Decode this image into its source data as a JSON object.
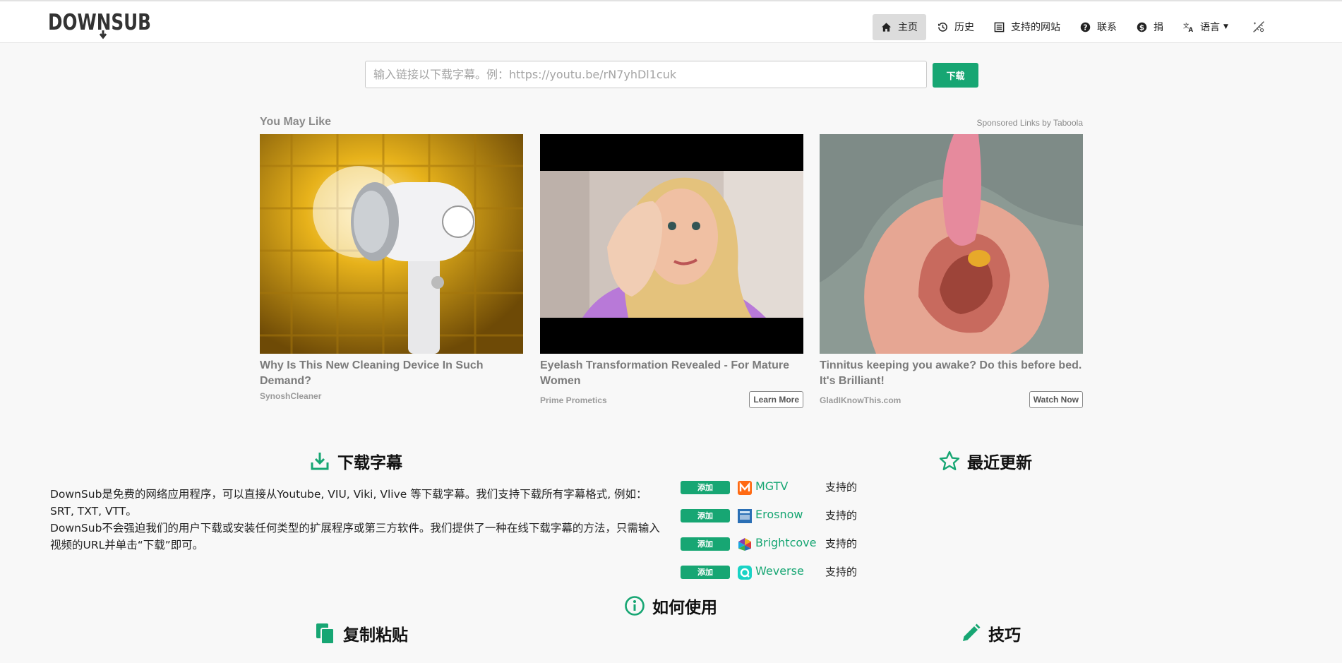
{
  "brand": {
    "logo_text": "DOWNSUB"
  },
  "nav": {
    "home": "主页",
    "history": "历史",
    "supported_sites": "支持的网站",
    "contact": "联系",
    "donate": "捐",
    "language": "语言"
  },
  "search": {
    "placeholder": "输入链接以下载字幕。例：https://youtu.be/rN7yhDl1cuk",
    "value": "",
    "button": "下载"
  },
  "ads": {
    "title": "You May Like",
    "sponsor": "Sponsored Links by Taboola",
    "items": [
      {
        "title": "Why Is This New Cleaning Device In Such Demand?",
        "brand": "SynoshCleaner",
        "cta": ""
      },
      {
        "title": "Eyelash Transformation Revealed - For Mature Women",
        "brand": "Prime Prometics",
        "cta": "Learn More"
      },
      {
        "title": "Tinnitus keeping you awake? Do this before bed. It's Brilliant!",
        "brand": "GladIKnowThis.com",
        "cta": "Watch Now"
      }
    ]
  },
  "download_section": {
    "heading": "下载字幕",
    "paragraph1": "DownSub是免费的网络应用程序，可以直接从Youtube, VIU, Viki, Vlive 等下载字幕。我们支持下载所有字幕格式, 例如：SRT, TXT, VTT。",
    "paragraph2": "DownSub不会强迫我们的用户下载或安装任何类型的扩展程序或第三方软件。我们提供了一种在线下载字幕的方法，只需输入视频的URL并单击“下载”即可。"
  },
  "recent_updates": {
    "heading": "最近更新",
    "items": [
      {
        "badge": "添加",
        "name": "MGTV",
        "status": "支持的",
        "logo": "mgtv-logo",
        "color": "#ff6a13"
      },
      {
        "badge": "添加",
        "name": "Erosnow",
        "status": "支持的",
        "logo": "erosnow-logo",
        "color": "#2a6fb5"
      },
      {
        "badge": "添加",
        "name": "Brightcove",
        "status": "支持的",
        "logo": "brightcove-logo",
        "color": "#8c3aa8"
      },
      {
        "badge": "添加",
        "name": "Weverse",
        "status": "支持的",
        "logo": "weverse-logo",
        "color": "#19d3c5"
      }
    ]
  },
  "how_to": {
    "heading": "如何使用"
  },
  "copy_paste": {
    "heading": "复制粘贴"
  },
  "tips": {
    "heading": "技巧"
  },
  "colors": {
    "accent": "#17a673",
    "nav_active_bg": "#dcdcdc",
    "background": "#f8f8f8"
  }
}
